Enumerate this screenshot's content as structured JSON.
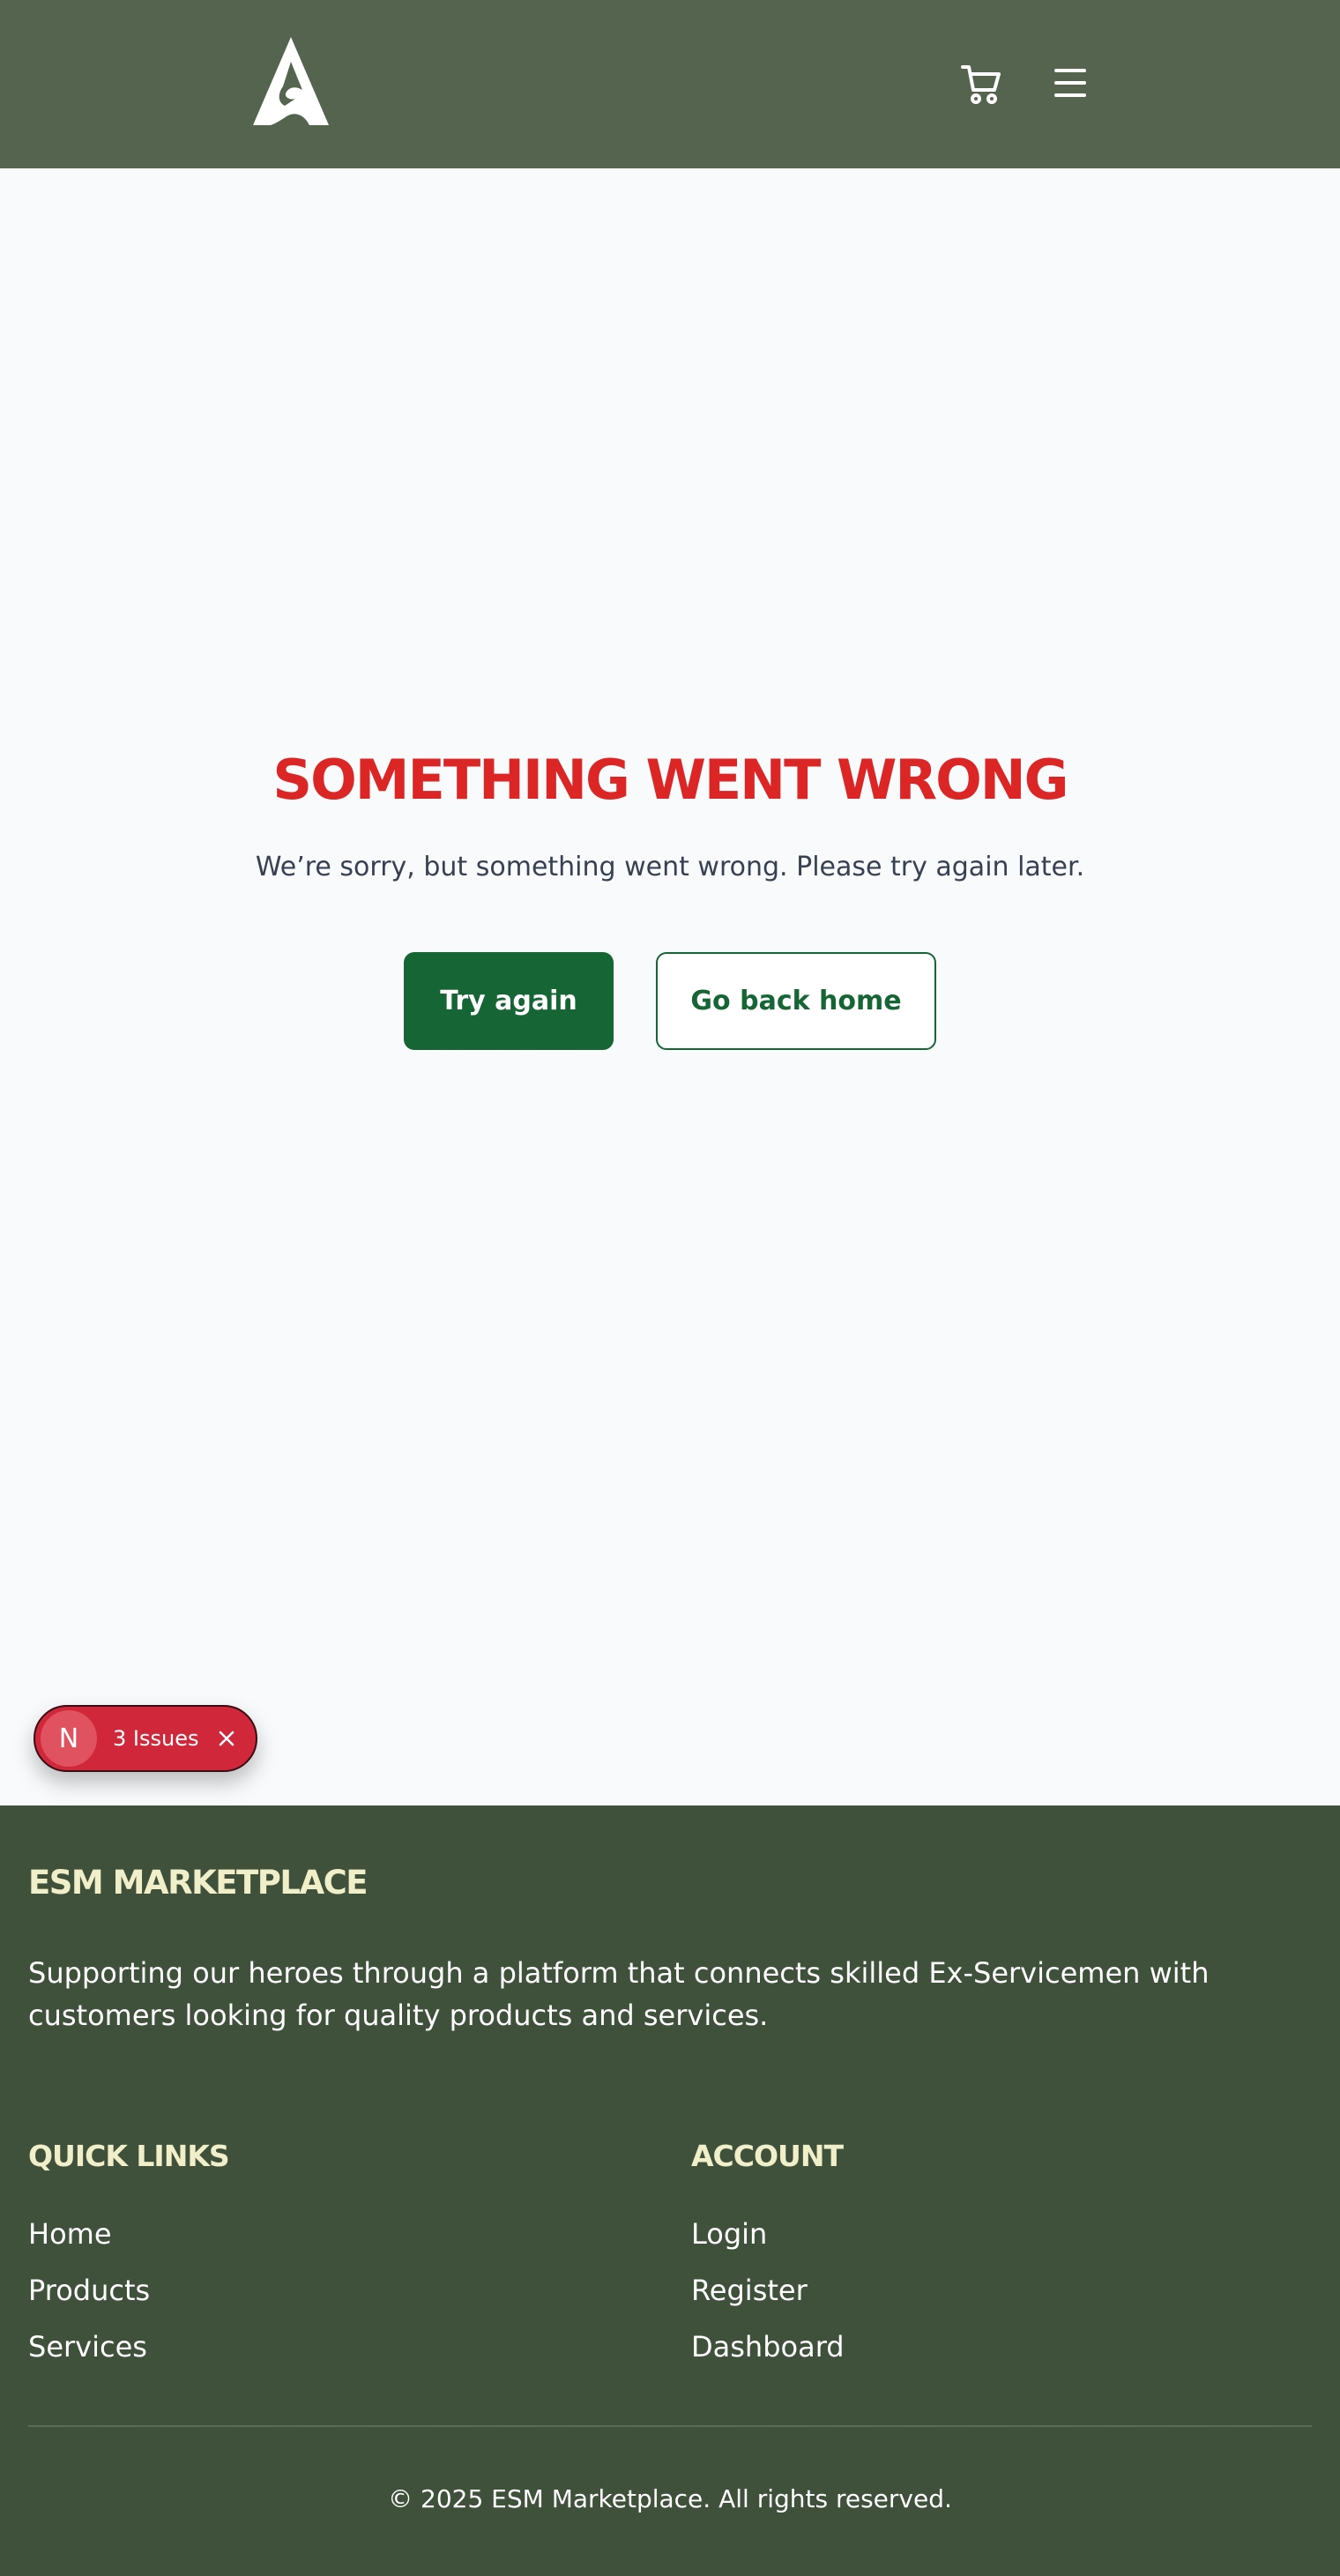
{
  "header": {
    "logo_icon": "mountain-logo-icon",
    "cart_icon": "shopping-cart-icon",
    "menu_icon": "hamburger-menu-icon"
  },
  "error": {
    "title": "SOMETHING WENT WRONG",
    "message": "We’re sorry, but something went wrong. Please try again later.",
    "try_again_label": "Try again",
    "home_label": "Go back home"
  },
  "issues_badge": {
    "icon_letter": "N",
    "label": "3 Issues",
    "close_icon": "close-icon"
  },
  "footer": {
    "brand": "ESM MARKETPLACE",
    "tagline": "Supporting our heroes through a platform that connects skilled Ex-Servicemen with customers looking for quality products and services.",
    "quick_links": {
      "title": "QUICK LINKS",
      "items": [
        "Home",
        "Products",
        "Services"
      ]
    },
    "account": {
      "title": "ACCOUNT",
      "items": [
        "Login",
        "Register",
        "Dashboard"
      ]
    },
    "copyright": "© 2025 ESM Marketplace. All rights reserved."
  },
  "colors": {
    "header_bg": "#55644f",
    "footer_bg": "#3f513b",
    "accent_green": "#166534",
    "error_red": "#dc2626",
    "footer_heading": "#f1efc9"
  }
}
